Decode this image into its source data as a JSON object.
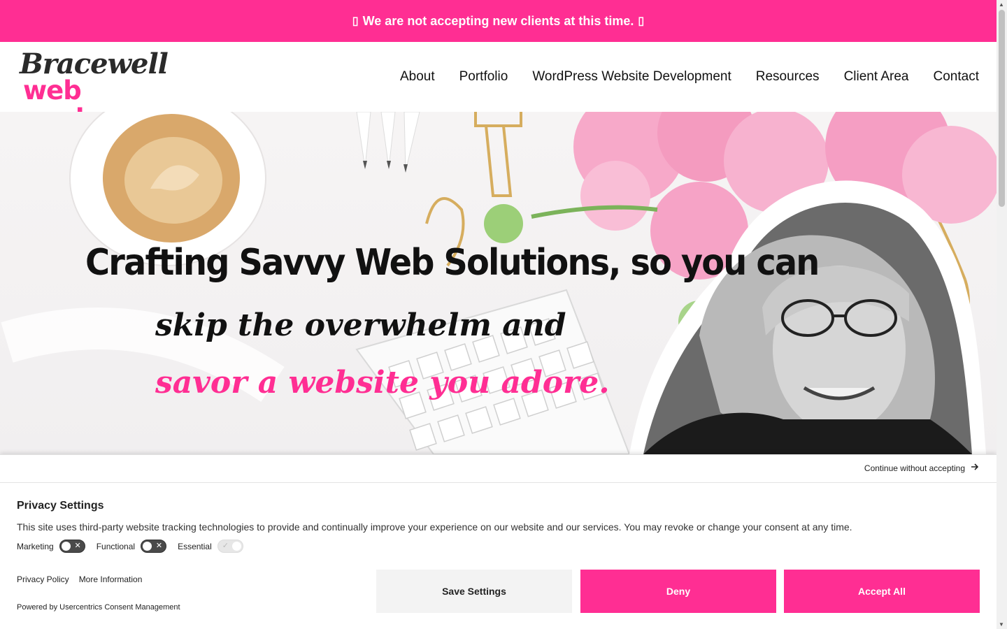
{
  "announcement": {
    "text": "We are not accepting new clients at this time.",
    "left_glyph": "▯",
    "right_glyph": "▯"
  },
  "logo": {
    "line1": "Bracewell",
    "line2": "web works"
  },
  "nav": {
    "items": [
      "About",
      "Portfolio",
      "WordPress Website Development",
      "Resources",
      "Client Area",
      "Contact"
    ]
  },
  "hero": {
    "line1": "Crafting Savvy Web Solutions, so you can",
    "line2": "skip the overwhelm and",
    "line3": "savor a website you adore."
  },
  "consent": {
    "continue_label": "Continue without accepting",
    "title": "Privacy Settings",
    "description": "This site uses third-party website tracking technologies to provide and continually improve your experience on our website and our services. You may revoke or change your consent at any time.",
    "toggles": [
      {
        "label": "Marketing",
        "state": "off"
      },
      {
        "label": "Functional",
        "state": "off"
      },
      {
        "label": "Essential",
        "state": "on-disabled"
      }
    ],
    "links": [
      "Privacy Policy",
      "More Information"
    ],
    "powered_by": "Powered by Usercentrics Consent Management",
    "buttons": {
      "save": "Save Settings",
      "deny": "Deny",
      "accept": "Accept All"
    }
  },
  "colors": {
    "brand_pink": "#ff2e93",
    "dark": "#2a2a2a",
    "button_grey": "#f3f3f3"
  },
  "icons": {
    "continue": "arrow-right-icon",
    "toggle_off": "close-icon",
    "toggle_on": "check-icon"
  }
}
